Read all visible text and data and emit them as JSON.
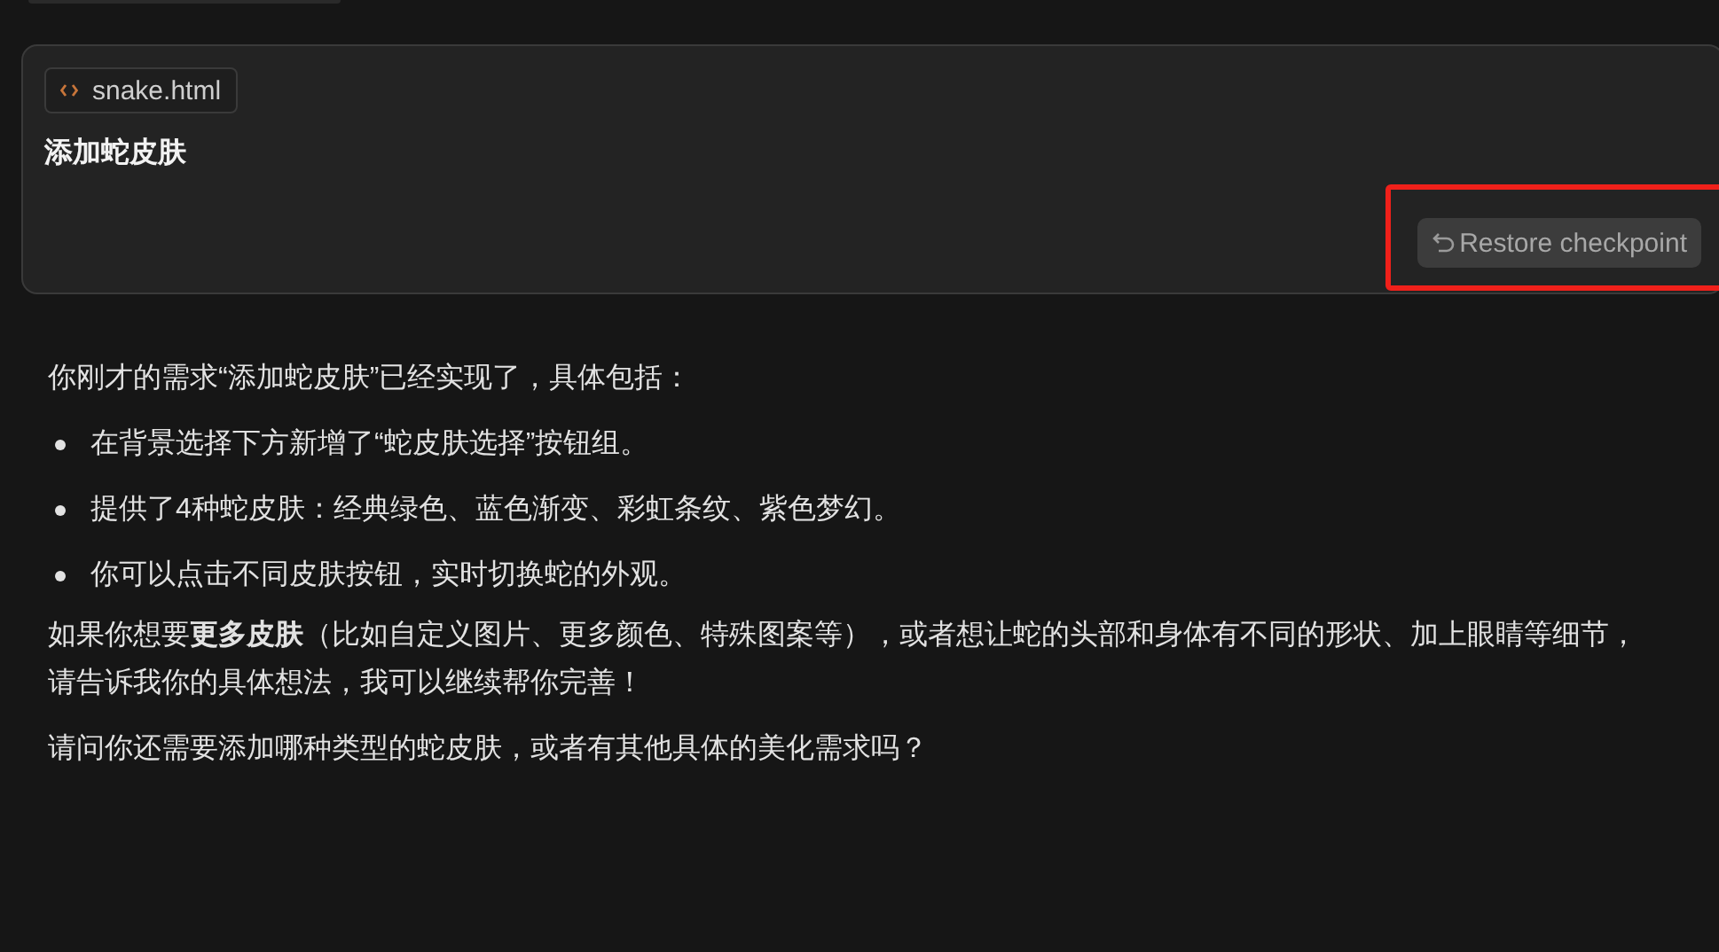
{
  "user_message": {
    "attachment": {
      "label": "snake.html"
    },
    "text": "添加蛇皮肤",
    "restore_button": {
      "label": "Restore checkpoint",
      "highlighted": true
    }
  },
  "response": {
    "intro": "你刚才的需求“添加蛇皮肤”已经实现了，具体包括：",
    "bullets": [
      "在背景选择下方新增了“蛇皮肤选择”按钮组。",
      "提供了4种蛇皮肤：经典绿色、蓝色渐变、彩虹条纹、紫色梦幻。",
      "你可以点击不同皮肤按钮，实时切换蛇的外观。"
    ],
    "paragraphs": [
      "如果你想要**更多皮肤**（比如自定义图片、更多颜色、特殊图案等），或者想让蛇的头部和身体有不同的形状、加上眼睛等细节，请告诉我你的具体想法，我可以继续帮你完善！",
      "请问你还需要添加哪种类型的蛇皮肤，或者有其他具体的美化需求吗？"
    ]
  }
}
